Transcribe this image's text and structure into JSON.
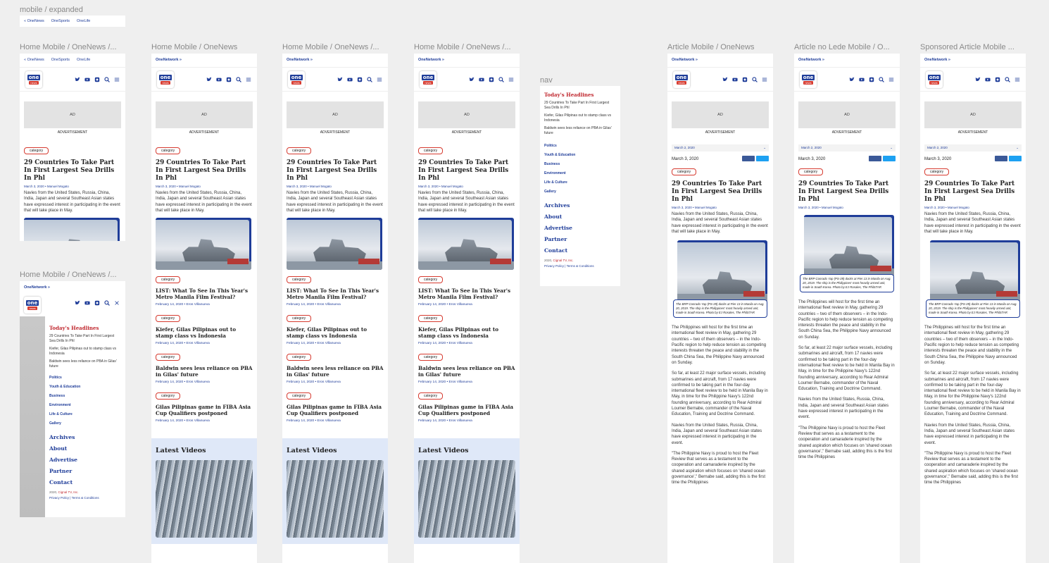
{
  "labels": {
    "expanded": "mobile / expanded",
    "home1": "Home Mobile / OneNews /...",
    "home2": "Home Mobile / OneNews",
    "home3": "Home Mobile / OneNews /...",
    "home4": "Home Mobile / OneNews /...",
    "home5": "Home Mobile / OneNews /...",
    "nav": "nav",
    "article": "Article Mobile / OneNews",
    "article_nolede": "Article no Lede Mobile / O...",
    "sponsored": "Sponsored Article Mobile ..."
  },
  "network": {
    "label": "OneNetwork »",
    "links": [
      "« OneNews",
      "OneSports",
      "OneLife"
    ]
  },
  "logo": {
    "top": "one",
    "bottom": "news"
  },
  "ad": {
    "box": "AD",
    "caption": "ADVERTISEMENT"
  },
  "lead": {
    "tag": "category",
    "title": "29 Countries To Take Part In First Largest Sea Drills In Phl",
    "meta": "March 3, 2020 • Manuel Mogato",
    "body": "Navies from the United States, Russia, China, India, Japan and several Southeast Asian states have expressed interest in participating in the event that will take place in May."
  },
  "stories": [
    {
      "tag": "category",
      "title": "LIST: What To See In This Year's Metro Manila Film Festival?",
      "meta": "February 14, 2020 • Eros Villanueva"
    },
    {
      "tag": "category",
      "title": "Kiefer, Gilas Pilipinas out to stamp class vs Indonesia",
      "meta": "February 14, 2020 • Eros Villanueva"
    },
    {
      "tag": "category",
      "title": "Baldwin sees less reliance on PBA in Gilas' future",
      "meta": "February 14, 2020 • Eros Villanueva"
    },
    {
      "tag": "category",
      "title": "Gilas Pilipinas game in FIBA Asia Cup Qualifiers postponed",
      "meta": "February 14, 2020 • Eros Villanueva"
    }
  ],
  "latest_videos": "Latest Videos",
  "nav": {
    "today": "Today's Headlines",
    "headlines": [
      "29 Countries To Take Part In First Largest Sea Drills In Phl",
      "Kiefer, Gilas Pilipinas out to stamp class vs Indonesia",
      "Baldwin sees less reliance on PBA in Gilas' future"
    ],
    "categories": [
      "Politics",
      "Youth & Education",
      "Business",
      "Environment",
      "Life & Culture",
      "Gallery"
    ],
    "pages": [
      "Archives",
      "About",
      "Advertise",
      "Partner",
      "Contact"
    ],
    "copyright_prefix": "2020, ",
    "copyright_brand": "Cignal TV, Inc.",
    "legal": "Privacy Policy  |  Terms & Conditions"
  },
  "article": {
    "dropdown": "March 2, 2020",
    "date": "March 3, 2020",
    "caption": "The BRP Conrado Yap (PS-39) docks at Pier 13 in Manila on Aug. 20, 2019. The ship is the Philippines' most heavily armed unit, made in South Korea. Photo by EJ Rosales, The PhilSTAR",
    "paragraphs": [
      "The Philippines will host for the first time an international fleet review in May, gathering 29 countries – two of them observers – in the Indo-Pacific region to help reduce tension as competing interests threaten the peace and stability in the South China Sea, the Philippine Navy announced on Sunday.",
      "So far, at least 22 major surface vessels, including submarines and aircraft, from 17 navies were confirmed to be taking part in the four-day international fleet review to be held in Manila Bay in May, in time for the Philippine Navy's 122nd founding anniversary, according to Rear Admiral Loumer Bernabe, commander of the Naval Education, Training and Doctrine Command.",
      "Navies from the United States, Russia, China, India, Japan and several Southeast Asian states have expressed interest in participating in the event.",
      "\"The Philippine Navy is proud to host the Fleet Review that serves as a testament to the cooperation and camaraderie inspired by the shared aspiration which focuses on 'shared ocean governance',\" Bernabe said, adding this is the first time the Philippines"
    ]
  }
}
